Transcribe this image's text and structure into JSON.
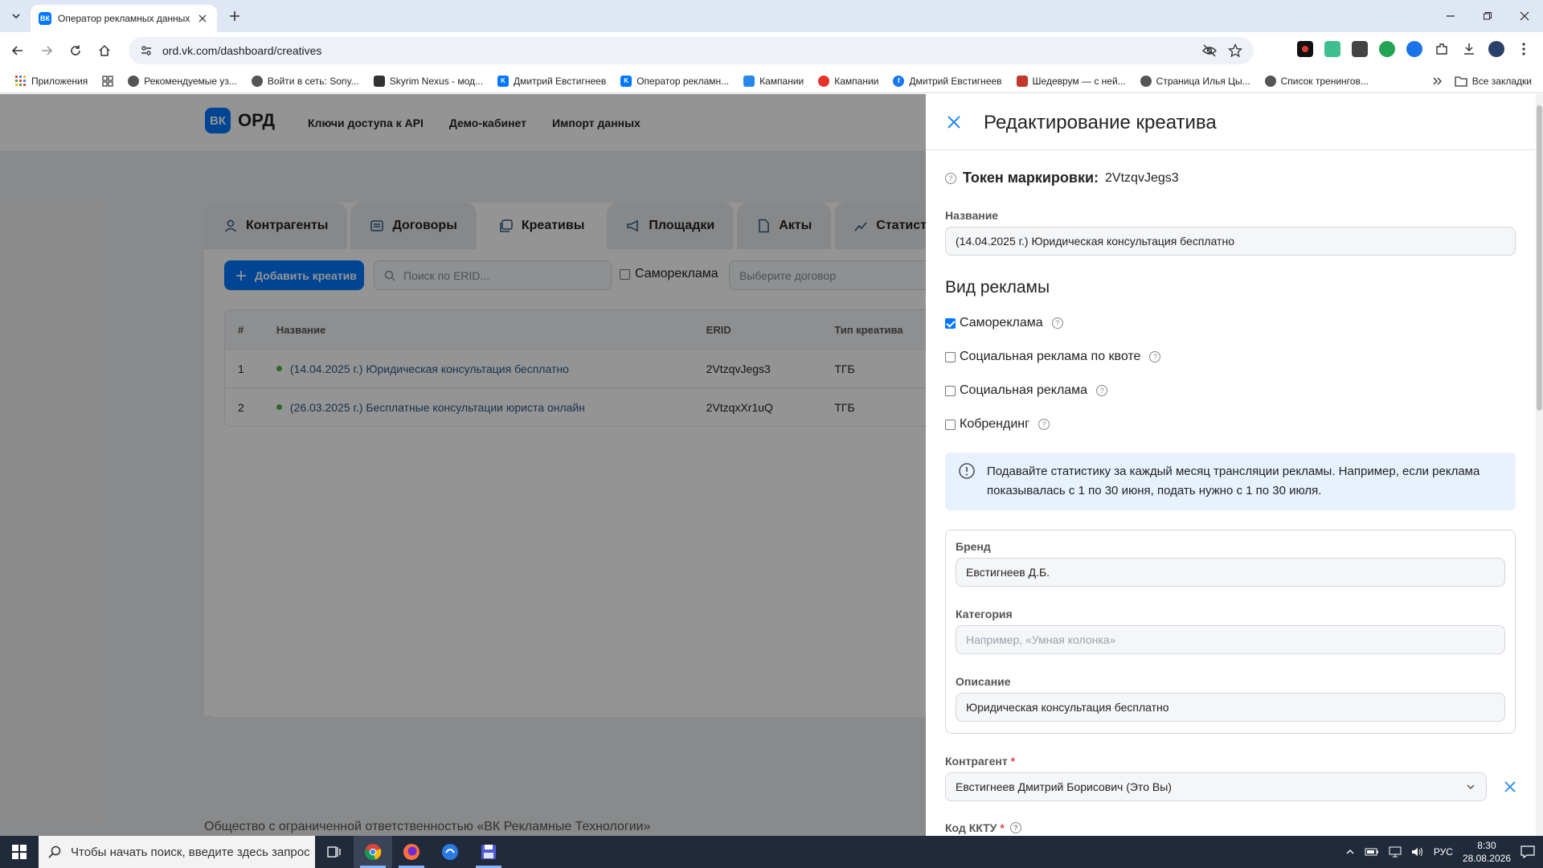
{
  "browser": {
    "tab_title": "Оператор рекламных данных",
    "tab_favicon": "ВК",
    "url": "ord.vk.com/dashboard/creatives",
    "bookmarks": [
      {
        "label": "Приложения",
        "icon": "apps-grid-icon"
      },
      {
        "label": "",
        "icon": "grid-icon"
      },
      {
        "label": "Рекомендуемые уз...",
        "icon": "globe-icon"
      },
      {
        "label": "Войти в сеть: Sony...",
        "icon": "globe-icon"
      },
      {
        "label": "Skyrim Nexus - мод...",
        "icon": "nexus-icon"
      },
      {
        "label": "Дмитрий Евстигнеев",
        "icon": "vk-icon"
      },
      {
        "label": "Оператор рекламн...",
        "icon": "vk-icon"
      },
      {
        "label": "Кампании",
        "icon": "vk-ads-icon"
      },
      {
        "label": "Кампании",
        "icon": "mytarget-icon"
      },
      {
        "label": "Дмитрий Евстигнеев",
        "icon": "facebook-icon"
      },
      {
        "label": "Шедеврум — с ней...",
        "icon": "shedevrum-icon"
      },
      {
        "label": "Страница Илья Цы...",
        "icon": "globe-icon"
      },
      {
        "label": "Список тренингов...",
        "icon": "globe-icon"
      }
    ],
    "all_bookmarks": "Все закладки"
  },
  "app": {
    "logo": "ВК",
    "brand": "ОРД",
    "nav": [
      "Ключи доступа к API",
      "Демо-кабинет",
      "Импорт данных"
    ],
    "tabs": [
      {
        "label": "Контрагенты",
        "icon": "user-icon",
        "active": false
      },
      {
        "label": "Договоры",
        "icon": "contract-icon",
        "active": false
      },
      {
        "label": "Креативы",
        "icon": "creatives-icon",
        "active": true
      },
      {
        "label": "Площадки",
        "icon": "megaphone-icon",
        "active": false
      },
      {
        "label": "Акты",
        "icon": "document-icon",
        "active": false
      },
      {
        "label": "Статисти",
        "icon": "chart-icon",
        "active": false
      }
    ],
    "add_button": "Добавить креатив",
    "search_placeholder": "Поиск по ERID...",
    "selfad_filter": "Самореклама",
    "contract_placeholder": "Выберите договор",
    "table": {
      "headers": [
        "#",
        "Название",
        "ERID",
        "Тип креатива"
      ],
      "rows": [
        {
          "num": "1",
          "name": "(14.04.2025 г.) Юридическая консультация бесплатно",
          "erid": "2VtzqvJegs3",
          "type": "ТГБ"
        },
        {
          "num": "2",
          "name": "(26.03.2025 г.) Бесплатные консультации юриста онлайн",
          "erid": "2VtzqxXr1uQ",
          "type": "ТГБ"
        }
      ]
    },
    "footer": "Общество с ограниченной ответственностью «ВК Рекламные Технологии»"
  },
  "panel": {
    "title": "Редактирование креатива",
    "token_label": "Токен маркировки:",
    "token_value": "2VtzqvJegs3",
    "name_label": "Название",
    "name_value": "(14.04.2025 г.) Юридическая консультация бесплатно",
    "ad_type_title": "Вид рекламы",
    "ad_types": [
      {
        "label": "Самореклама",
        "checked": true
      },
      {
        "label": "Социальная реклама по квоте",
        "checked": false
      },
      {
        "label": "Социальная реклама",
        "checked": false
      },
      {
        "label": "Кобрендинг",
        "checked": false
      }
    ],
    "info_text": "Подавайте статистику за каждый месяц трансляции рекламы. Например, если реклама показывалась с 1 по 30 июня, подать нужно с 1 по 30 июля.",
    "brand_label": "Бренд",
    "brand_value": "Евстигнеев Д.Б.",
    "category_label": "Категория",
    "category_placeholder": "Например, «Умная колонка»",
    "description_label": "Описание",
    "description_value": "Юридическая консультация бесплатно",
    "counterparty_label": "Контрагент",
    "counterparty_value": "Евстигнеев Дмитрий Борисович (Это Вы)",
    "kktu_label": "Код ККТУ",
    "required_mark": "*"
  },
  "taskbar": {
    "search_placeholder": "Чтобы начать поиск, введите здесь запрос",
    "language": "РУС",
    "time": "8:30",
    "date": "28.08.2026"
  },
  "colors": {
    "accent": "#0077ff",
    "link": "#2a5885",
    "status_green": "#4bb34b",
    "required": "#e64646",
    "info_bg": "#e8f2ff"
  }
}
